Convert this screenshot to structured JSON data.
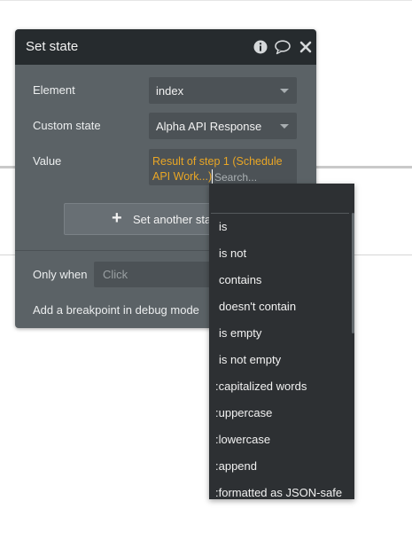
{
  "panel": {
    "title": "Set state",
    "header_icons": [
      "info-icon",
      "comment-icon",
      "close-icon"
    ],
    "element_label": "Element",
    "element_value": "index",
    "custom_state_label": "Custom state",
    "custom_state_value": "Alpha API Response",
    "value_label": "Value",
    "value_expression": "Result of step 1 (Schedule API Work...)",
    "search_placeholder": "Search...",
    "add_button_label": "Set another sta",
    "only_when_label": "Only when",
    "only_when_placeholder": "Click",
    "breakpoint_label": "Add a breakpoint in debug mode"
  },
  "menu": {
    "items": [
      "is",
      "is not",
      "contains",
      "doesn't contain",
      "is empty",
      "is not empty",
      ":capitalized words",
      ":uppercase",
      ":lowercase",
      ":append",
      ":formatted as JSON-safe"
    ]
  },
  "colors": {
    "panel_bg": "#5b6266",
    "header_bg": "#262b2e",
    "dynamic_expression": "#e9a625",
    "menu_bg": "#2d3033"
  }
}
